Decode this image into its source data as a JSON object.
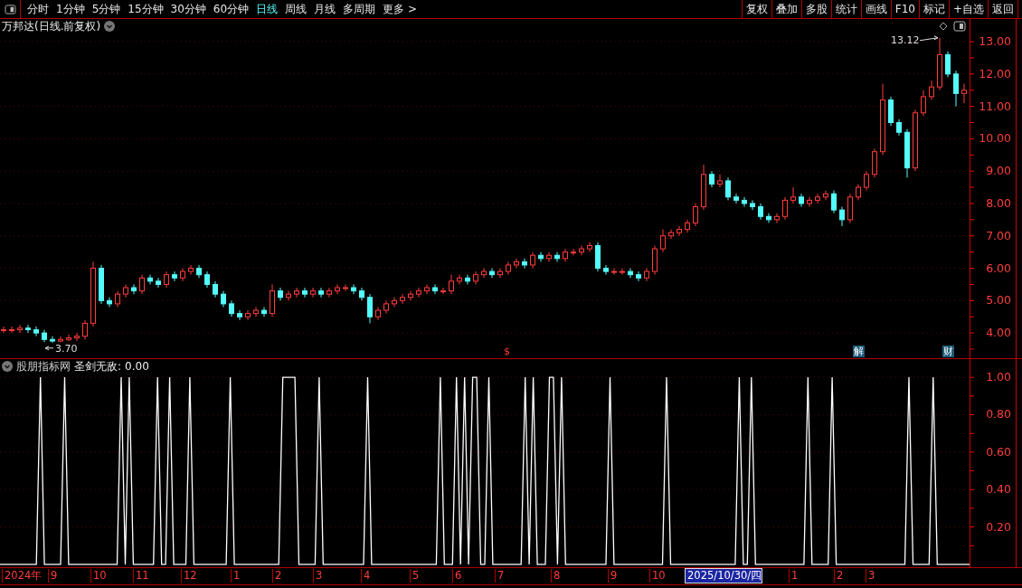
{
  "toolbar": {
    "tabs": [
      {
        "label": "分时",
        "selected": false
      },
      {
        "label": "1分钟",
        "selected": false
      },
      {
        "label": "5分钟",
        "selected": false
      },
      {
        "label": "15分钟",
        "selected": false
      },
      {
        "label": "30分钟",
        "selected": false
      },
      {
        "label": "60分钟",
        "selected": false
      },
      {
        "label": "日线",
        "selected": true
      },
      {
        "label": "周线",
        "selected": false
      },
      {
        "label": "月线",
        "selected": false
      },
      {
        "label": "多周期",
        "selected": false
      },
      {
        "label": "更多 >",
        "selected": false
      }
    ],
    "buttons": [
      "复权",
      "叠加",
      "多股",
      "统计",
      "画线",
      "F10",
      "标记",
      "+自选",
      "返回"
    ]
  },
  "price_pane": {
    "title": "万邦达(日线.前复权)",
    "chart_data": {
      "type": "candlestick",
      "ylim": [
        3.22,
        13.7
      ],
      "yticks": [
        {
          "value": 13,
          "label": "13.00"
        },
        {
          "value": 12,
          "label": "12.00"
        },
        {
          "value": 11,
          "label": "11.00"
        },
        {
          "value": 10,
          "label": "10.00"
        },
        {
          "value": 9,
          "label": "9.00"
        },
        {
          "value": 8,
          "label": "8.00"
        },
        {
          "value": 7,
          "label": "7.00"
        },
        {
          "value": 6,
          "label": "6.00"
        },
        {
          "value": 5,
          "label": "5.00"
        },
        {
          "value": 4,
          "label": "4.00"
        }
      ],
      "grid": true,
      "ohlc": [
        [
          4.1,
          4.2,
          4.0,
          4.1
        ],
        [
          4.1,
          4.2,
          4.0,
          4.1
        ],
        [
          4.1,
          4.25,
          4.0,
          4.15
        ],
        [
          4.15,
          4.25,
          4.0,
          4.1
        ],
        [
          4.1,
          4.2,
          3.9,
          4.0
        ],
        [
          4.0,
          4.1,
          3.72,
          3.8
        ],
        [
          3.8,
          3.9,
          3.7,
          3.75
        ],
        [
          3.75,
          3.9,
          3.72,
          3.8
        ],
        [
          3.8,
          3.95,
          3.75,
          3.85
        ],
        [
          3.85,
          4.0,
          3.75,
          3.9
        ],
        [
          3.9,
          4.4,
          3.8,
          4.3
        ],
        [
          4.3,
          6.2,
          4.2,
          6.0
        ],
        [
          6.0,
          6.1,
          4.9,
          5.0
        ],
        [
          5.0,
          5.1,
          4.8,
          4.9
        ],
        [
          4.9,
          5.3,
          4.8,
          5.2
        ],
        [
          5.2,
          5.5,
          5.1,
          5.4
        ],
        [
          5.4,
          5.5,
          5.2,
          5.3
        ],
        [
          5.3,
          5.8,
          5.2,
          5.7
        ],
        [
          5.7,
          5.8,
          5.5,
          5.6
        ],
        [
          5.6,
          5.7,
          5.4,
          5.5
        ],
        [
          5.5,
          5.9,
          5.4,
          5.8
        ],
        [
          5.8,
          5.9,
          5.6,
          5.7
        ],
        [
          5.7,
          6.0,
          5.6,
          5.9
        ],
        [
          5.9,
          6.1,
          5.8,
          6.0
        ],
        [
          6.0,
          6.1,
          5.7,
          5.8
        ],
        [
          5.8,
          5.9,
          5.4,
          5.5
        ],
        [
          5.5,
          5.6,
          5.1,
          5.2
        ],
        [
          5.2,
          5.3,
          4.8,
          4.9
        ],
        [
          4.9,
          5.0,
          4.5,
          4.6
        ],
        [
          4.6,
          4.7,
          4.4,
          4.5
        ],
        [
          4.5,
          4.7,
          4.4,
          4.6
        ],
        [
          4.6,
          4.8,
          4.5,
          4.7
        ],
        [
          4.7,
          4.8,
          4.5,
          4.6
        ],
        [
          4.6,
          5.5,
          4.5,
          5.3
        ],
        [
          5.3,
          5.4,
          5.0,
          5.1
        ],
        [
          5.1,
          5.3,
          5.0,
          5.2
        ],
        [
          5.2,
          5.4,
          5.1,
          5.3
        ],
        [
          5.3,
          5.4,
          5.1,
          5.2
        ],
        [
          5.2,
          5.4,
          5.1,
          5.3
        ],
        [
          5.3,
          5.4,
          5.1,
          5.2
        ],
        [
          5.2,
          5.4,
          5.1,
          5.3
        ],
        [
          5.3,
          5.5,
          5.2,
          5.4
        ],
        [
          5.4,
          5.5,
          5.3,
          5.4
        ],
        [
          5.4,
          5.5,
          5.2,
          5.3
        ],
        [
          5.3,
          5.4,
          5.0,
          5.1
        ],
        [
          5.1,
          5.2,
          4.3,
          4.5
        ],
        [
          4.5,
          4.8,
          4.4,
          4.7
        ],
        [
          4.7,
          5.0,
          4.6,
          4.9
        ],
        [
          4.9,
          5.1,
          4.8,
          5.0
        ],
        [
          5.0,
          5.2,
          4.9,
          5.1
        ],
        [
          5.1,
          5.3,
          5.0,
          5.2
        ],
        [
          5.2,
          5.4,
          5.1,
          5.3
        ],
        [
          5.3,
          5.5,
          5.2,
          5.4
        ],
        [
          5.4,
          5.5,
          5.2,
          5.3
        ],
        [
          5.3,
          5.4,
          5.2,
          5.3
        ],
        [
          5.3,
          5.8,
          5.2,
          5.6
        ],
        [
          5.6,
          5.8,
          5.5,
          5.7
        ],
        [
          5.7,
          5.8,
          5.5,
          5.6
        ],
        [
          5.6,
          5.9,
          5.5,
          5.8
        ],
        [
          5.8,
          6.0,
          5.7,
          5.9
        ],
        [
          5.9,
          6.0,
          5.7,
          5.8
        ],
        [
          5.8,
          6.0,
          5.7,
          5.9
        ],
        [
          5.9,
          6.2,
          5.8,
          6.1
        ],
        [
          6.1,
          6.3,
          6.0,
          6.2
        ],
        [
          6.2,
          6.3,
          6.0,
          6.1
        ],
        [
          6.1,
          6.5,
          6.0,
          6.4
        ],
        [
          6.4,
          6.5,
          6.2,
          6.3
        ],
        [
          6.3,
          6.5,
          6.2,
          6.4
        ],
        [
          6.4,
          6.5,
          6.2,
          6.3
        ],
        [
          6.3,
          6.6,
          6.2,
          6.5
        ],
        [
          6.5,
          6.6,
          6.4,
          6.5
        ],
        [
          6.5,
          6.7,
          6.4,
          6.6
        ],
        [
          6.6,
          6.8,
          6.5,
          6.7
        ],
        [
          6.7,
          6.8,
          5.9,
          6.0
        ],
        [
          6.0,
          6.1,
          5.8,
          5.9
        ],
        [
          5.9,
          6.0,
          5.8,
          5.9
        ],
        [
          5.9,
          6.0,
          5.8,
          5.9
        ],
        [
          5.9,
          6.0,
          5.7,
          5.8
        ],
        [
          5.8,
          5.9,
          5.6,
          5.7
        ],
        [
          5.7,
          6.0,
          5.6,
          5.9
        ],
        [
          5.9,
          6.7,
          5.8,
          6.6
        ],
        [
          6.6,
          7.2,
          6.5,
          7.0
        ],
        [
          7.0,
          7.2,
          6.9,
          7.1
        ],
        [
          7.1,
          7.3,
          7.0,
          7.2
        ],
        [
          7.2,
          7.5,
          7.1,
          7.4
        ],
        [
          7.4,
          8.0,
          7.3,
          7.9
        ],
        [
          7.9,
          9.2,
          7.8,
          8.9
        ],
        [
          8.9,
          9.0,
          8.5,
          8.6
        ],
        [
          8.6,
          8.9,
          8.5,
          8.7
        ],
        [
          8.7,
          8.8,
          8.1,
          8.2
        ],
        [
          8.2,
          8.3,
          8.0,
          8.1
        ],
        [
          8.1,
          8.2,
          7.9,
          8.0
        ],
        [
          8.0,
          8.1,
          7.8,
          7.9
        ],
        [
          7.9,
          8.0,
          7.5,
          7.6
        ],
        [
          7.6,
          7.7,
          7.4,
          7.5
        ],
        [
          7.5,
          7.7,
          7.4,
          7.6
        ],
        [
          7.6,
          8.2,
          7.5,
          8.1
        ],
        [
          8.1,
          8.5,
          8.0,
          8.2
        ],
        [
          8.2,
          8.3,
          7.9,
          8.0
        ],
        [
          8.0,
          8.2,
          7.9,
          8.1
        ],
        [
          8.1,
          8.3,
          8.0,
          8.2
        ],
        [
          8.2,
          8.4,
          8.1,
          8.3
        ],
        [
          8.3,
          8.4,
          7.7,
          7.8
        ],
        [
          7.8,
          7.9,
          7.3,
          7.5
        ],
        [
          7.5,
          8.3,
          7.4,
          8.2
        ],
        [
          8.2,
          8.6,
          8.1,
          8.5
        ],
        [
          8.5,
          9.0,
          8.4,
          8.9
        ],
        [
          8.9,
          9.7,
          8.8,
          9.6
        ],
        [
          9.6,
          11.7,
          9.5,
          11.2
        ],
        [
          11.2,
          11.3,
          10.4,
          10.5
        ],
        [
          10.5,
          10.6,
          10.1,
          10.2
        ],
        [
          10.2,
          10.3,
          8.8,
          9.1
        ],
        [
          9.1,
          10.9,
          9.0,
          10.8
        ],
        [
          10.8,
          11.5,
          10.7,
          11.3
        ],
        [
          11.3,
          11.8,
          11.2,
          11.6
        ],
        [
          11.6,
          13.12,
          11.5,
          12.6
        ],
        [
          12.6,
          12.7,
          11.9,
          12.0
        ],
        [
          12.0,
          12.1,
          11.0,
          11.4
        ],
        [
          11.4,
          11.7,
          11.1,
          11.5
        ]
      ],
      "annotations": [
        "13.12",
        "3.70",
        "$",
        "解",
        "财"
      ]
    }
  },
  "indicator_pane": {
    "source": "股朋指标网",
    "name": "圣剑无敌:",
    "reading": "0.00",
    "chart_data": {
      "type": "line",
      "grid": true,
      "ylim": [
        -0.015,
        1.097
      ],
      "yticks": [
        {
          "value": 1,
          "label": "1.00"
        },
        {
          "value": 0.8,
          "label": "0.80"
        },
        {
          "value": 0.6,
          "label": "0.60"
        },
        {
          "value": 0.4,
          "label": "0.40"
        },
        {
          "value": 0.2,
          "label": "0.20"
        }
      ],
      "series": [
        {
          "color": "#ffffff",
          "values": [
            0,
            0,
            0,
            0,
            0,
            0,
            0,
            0,
            0,
            0,
            1,
            0,
            0,
            0,
            0,
            0,
            1,
            0,
            0,
            0,
            0,
            0,
            0,
            0,
            0,
            0,
            0,
            0,
            0,
            0,
            1,
            0,
            1,
            0,
            0,
            0,
            0,
            0,
            0,
            1,
            0,
            0,
            1,
            0,
            0,
            0,
            0,
            1,
            0,
            0,
            0,
            0,
            0,
            0,
            0,
            0,
            0,
            1,
            0,
            0,
            0,
            0,
            0,
            0,
            0,
            0,
            0,
            0,
            0,
            0,
            1,
            1,
            1,
            1,
            0,
            0,
            0,
            0,
            0,
            1,
            0,
            0,
            0,
            0,
            0,
            0,
            0,
            0,
            0,
            0,
            0,
            1,
            0,
            0,
            0,
            0,
            0,
            0,
            0,
            0,
            0,
            0,
            0,
            0,
            0,
            0,
            0,
            0,
            0,
            1,
            0,
            0,
            0,
            1,
            0,
            1,
            0,
            1,
            1,
            0,
            0,
            1,
            0,
            0,
            0,
            0,
            0,
            0,
            0,
            0,
            1,
            0,
            1,
            0,
            0,
            0,
            1,
            1,
            0,
            1,
            0,
            0,
            0,
            0,
            0,
            0,
            0,
            0,
            0,
            0,
            0,
            1,
            0,
            0,
            0,
            0,
            0,
            0,
            0,
            0,
            0,
            0,
            0,
            0,
            0,
            1,
            0,
            0,
            0,
            0,
            0,
            0,
            0,
            0,
            0,
            0,
            0,
            0,
            0,
            0,
            0,
            0,
            0,
            1,
            0,
            0,
            1,
            0,
            0,
            0,
            0,
            0,
            0,
            0,
            0,
            0,
            0,
            0,
            0,
            0,
            1,
            0,
            0,
            0,
            0,
            0,
            1,
            0,
            0,
            0,
            0,
            0,
            0,
            0,
            0,
            0,
            0,
            0,
            0,
            0,
            0,
            0,
            0,
            0,
            0,
            1,
            0,
            0,
            0,
            0,
            0,
            1,
            0,
            0,
            0,
            0,
            0,
            0,
            0,
            0,
            0
          ]
        }
      ]
    }
  },
  "time_axis": [
    {
      "text": "2024年",
      "selected": false
    },
    {
      "text": "9",
      "selected": false
    },
    {
      "text": "10",
      "selected": false
    },
    {
      "text": "11",
      "selected": false
    },
    {
      "text": "12",
      "selected": false
    },
    {
      "text": "1",
      "selected": false
    },
    {
      "text": "2",
      "selected": false
    },
    {
      "text": "3",
      "selected": false
    },
    {
      "text": "4",
      "selected": false
    },
    {
      "text": "5",
      "selected": false
    },
    {
      "text": "6",
      "selected": false
    },
    {
      "text": "7",
      "selected": false
    },
    {
      "text": "8",
      "selected": false
    },
    {
      "text": "9",
      "selected": false
    },
    {
      "text": "10",
      "selected": false
    },
    {
      "text": "2025/10/30/四",
      "selected": true
    },
    {
      "text": "1",
      "selected": false
    },
    {
      "text": "2",
      "selected": false
    },
    {
      "text": "3",
      "selected": false
    }
  ]
}
